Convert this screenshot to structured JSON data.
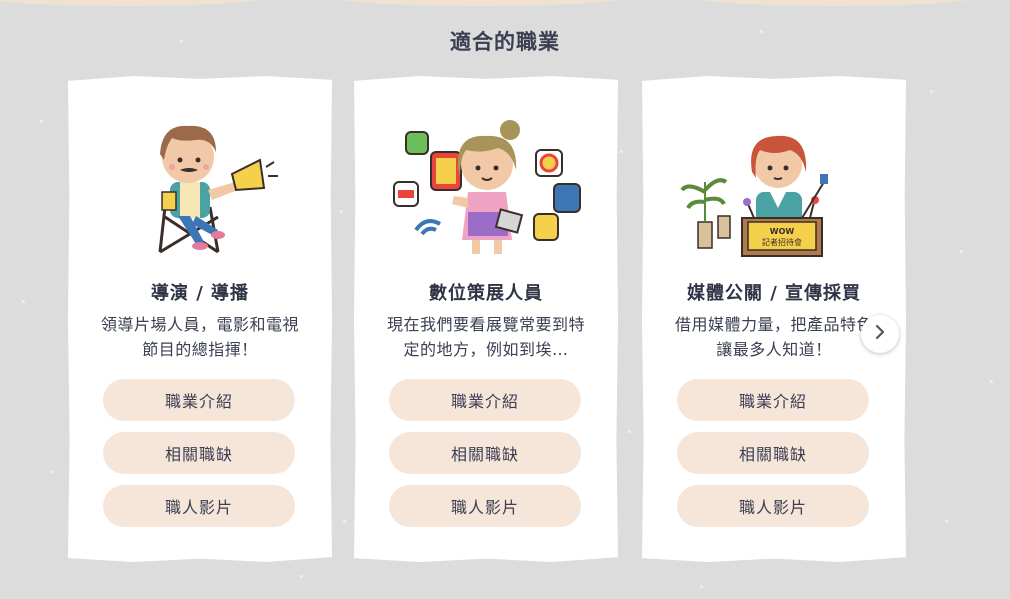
{
  "section": {
    "title": "適合的職業"
  },
  "cards": [
    {
      "title": "導演 / 導播",
      "description": "領導片場人員，電影和電視節目的總指揮！",
      "illustration": "director-with-megaphone",
      "buttons": [
        "職業介紹",
        "相關職缺",
        "職人影片"
      ]
    },
    {
      "title": "數位策展人員",
      "description": "現在我們要看展覽常要到特定的地方，例如到埃…",
      "illustration": "curator-with-app-icons",
      "buttons": [
        "職業介紹",
        "相關職缺",
        "職人影片"
      ]
    },
    {
      "title": "媒體公關 / 宣傳採買",
      "description": "借用媒體力量，把產品特色讓最多人知道！",
      "illustration": "pr-at-press-conference",
      "podium_text": [
        "WOW",
        "記者招待會"
      ],
      "buttons": [
        "職業介紹",
        "相關職缺",
        "職人影片"
      ]
    }
  ],
  "carousel": {
    "next_icon": "chevron-right-icon"
  },
  "colors": {
    "background": "#dcdcdc",
    "card": "#ffffff",
    "button": "#f6e5d9",
    "text": "#3a3f52"
  }
}
